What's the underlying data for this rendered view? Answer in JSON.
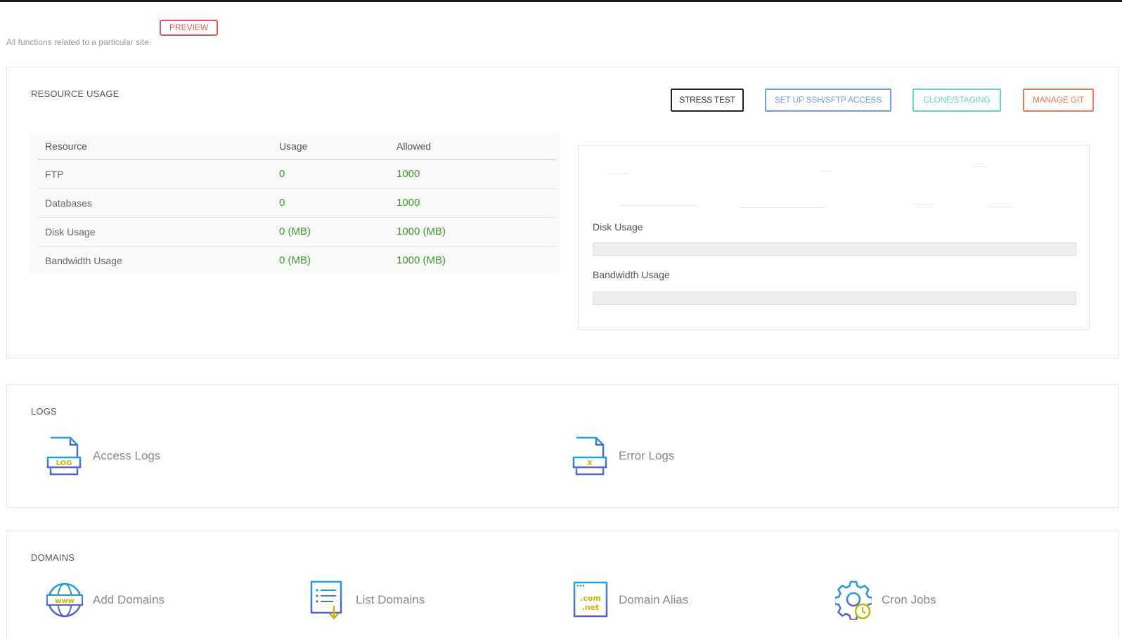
{
  "header": {
    "badge": "PREVIEW",
    "subtitle": "All functions related to a particular site."
  },
  "resource_usage": {
    "title": "RESOURCE USAGE",
    "buttons": {
      "stress_test": "STRESS TEST",
      "ssh": "SET UP SSH/SFTP ACCESS",
      "clone": "CLONE/STAGING",
      "git": "MANAGE GIT"
    },
    "table": {
      "headers": [
        "Resource",
        "Usage",
        "Allowed"
      ],
      "rows": [
        [
          "FTP",
          "0",
          "1000"
        ],
        [
          "Databases",
          "0",
          "1000"
        ],
        [
          "Disk Usage",
          "0 (MB)",
          "1000 (MB)"
        ],
        [
          "Bandwidth Usage",
          "0 (MB)",
          "1000 (MB)"
        ]
      ]
    },
    "bars": {
      "disk_label": "Disk Usage",
      "disk_percent": 0,
      "bandwidth_label": "Bandwidth Usage",
      "bandwidth_percent": 0
    }
  },
  "logs": {
    "title": "LOGS",
    "items": [
      {
        "label": "Access Logs",
        "icon": "access-log-icon",
        "icon_text": "LOG"
      },
      {
        "label": "Error Logs",
        "icon": "error-log-icon",
        "icon_text": "X"
      }
    ]
  },
  "domains": {
    "title": "DOMAINS",
    "items": [
      {
        "label": "Add Domains",
        "icon": "globe-www-icon",
        "icon_text": "www"
      },
      {
        "label": "List Domains",
        "icon": "list-domains-icon"
      },
      {
        "label": "Domain Alias",
        "icon": "domain-alias-icon",
        "icon_text_1": ".com",
        "icon_text_2": ".net"
      },
      {
        "label": "Cron Jobs",
        "icon": "gear-clock-icon"
      }
    ]
  },
  "colors": {
    "brand_blue": "#1fa0e0",
    "icon_purple": "#5b5bc8",
    "icon_yellow": "#c7b500",
    "value_green": "#3f9a2e",
    "preview_red": "#e05a5a"
  }
}
